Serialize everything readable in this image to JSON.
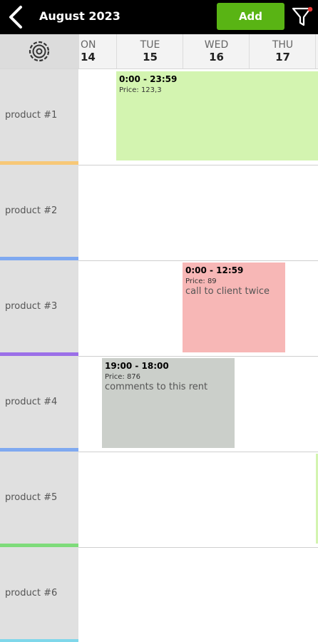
{
  "header": {
    "title": "August 2023",
    "add_label": "Add"
  },
  "days": [
    {
      "dow": "ON",
      "num": "14"
    },
    {
      "dow": "TUE",
      "num": "15"
    },
    {
      "dow": "WED",
      "num": "16"
    },
    {
      "dow": "THU",
      "num": "17"
    }
  ],
  "products": [
    {
      "label": "product #1",
      "stripe": "#f7c877"
    },
    {
      "label": "product #2",
      "stripe": "#7fa9f0"
    },
    {
      "label": "product #3",
      "stripe": "#9b6fe8"
    },
    {
      "label": "product #4",
      "stripe": "#7fa9f0"
    },
    {
      "label": "product #5",
      "stripe": "#7edb7a"
    },
    {
      "label": "product #6",
      "stripe": "#7fd7ea"
    }
  ],
  "rents": [
    {
      "time": "0:00 - 23:59",
      "price": "Price: 123,3",
      "comment": "",
      "color": "#d3f4b0"
    },
    {
      "time": "0:00 - 12:59",
      "price": "Price: 89",
      "comment": "call to client twice",
      "color": "#f7b7b6"
    },
    {
      "time": "19:00 - 18:00",
      "price": "Price: 876",
      "comment": "comments to this rent",
      "color": "#cbcfca"
    }
  ],
  "icons": {
    "back": "chevron-left-icon",
    "filter": "filter-icon",
    "settings": "gear-icon"
  },
  "colors": {
    "topbar": "#000000",
    "add_button": "#59b414",
    "filter_dot": "#e53935"
  }
}
